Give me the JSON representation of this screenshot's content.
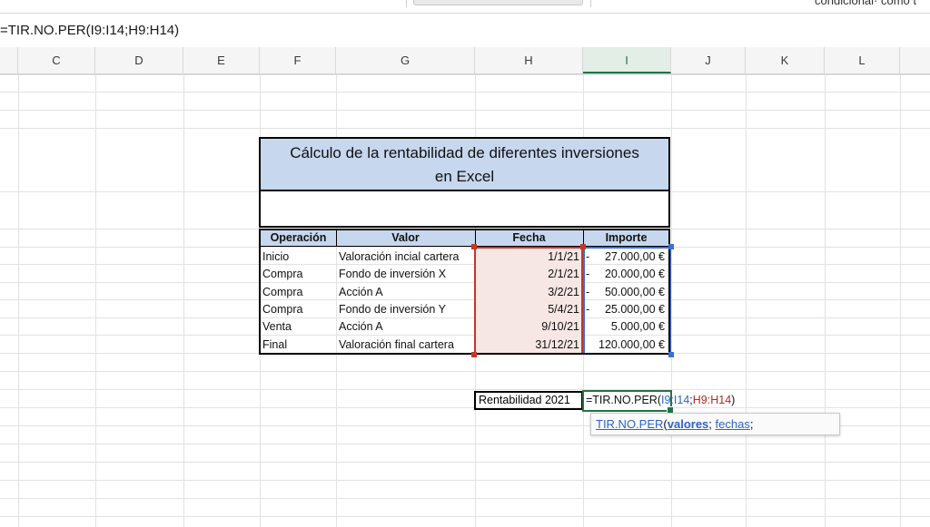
{
  "toolbar": {
    "right_text": "condicional· como t"
  },
  "formula_bar": {
    "formula": "=TIR.NO.PER(I9:I14;H9:H14)"
  },
  "columns": [
    "C",
    "D",
    "E",
    "F",
    "G",
    "H",
    "I",
    "J",
    "K",
    "L"
  ],
  "selected_column": "I",
  "sheet": {
    "title_line1": "Cálculo de la rentabilidad de diferentes inversiones",
    "title_line2": "en Excel",
    "headers": {
      "operacion": "Operación",
      "valor": "Valor",
      "fecha": "Fecha",
      "importe": "Importe"
    },
    "rows": [
      {
        "operacion": "Inicio",
        "valor": "Valoración incial cartera",
        "fecha": "1/1/21",
        "sign": "-",
        "importe": "27.000,00 €"
      },
      {
        "operacion": "Compra",
        "valor": "Fondo de inversión X",
        "fecha": "2/1/21",
        "sign": "-",
        "importe": "20.000,00 €"
      },
      {
        "operacion": "Compra",
        "valor": "Acción A",
        "fecha": "3/2/21",
        "sign": "-",
        "importe": "50.000,00 €"
      },
      {
        "operacion": "Compra",
        "valor": "Fondo de inversión Y",
        "fecha": "5/4/21",
        "sign": "-",
        "importe": "25.000,00 €"
      },
      {
        "operacion": "Venta",
        "valor": "Acción A",
        "fecha": "9/10/21",
        "sign": "",
        "importe": "5.000,00 €"
      },
      {
        "operacion": "Final",
        "valor": "Valoración final cartera",
        "fecha": "31/12/21",
        "sign": "",
        "importe": "120.000,00 €"
      }
    ],
    "rentabilidad_label": "Rentabilidad 2021",
    "editing": {
      "part1": "=TIR.NO.PER(",
      "range_values": "I9:I14",
      "sep": ";",
      "range_dates": "H9:H14",
      "close": ")"
    },
    "tooltip": {
      "func": "TIR.NO.PER",
      "open": "(",
      "arg1": "valores",
      "sep1": "; ",
      "arg2": "fechas",
      "sep2": ";"
    }
  },
  "colors": {
    "header_fill": "#c6d7ee",
    "accent_green": "#217346",
    "range_red": "#c0392b",
    "range_blue": "#3a6fd0"
  }
}
